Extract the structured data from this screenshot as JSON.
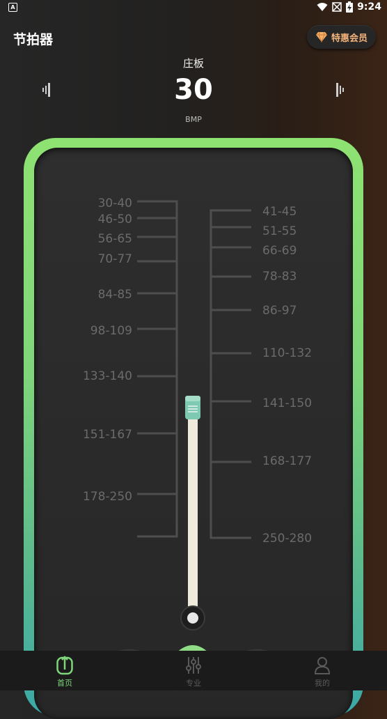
{
  "status_bar": {
    "time": "9:24",
    "notification_icon": "A"
  },
  "header": {
    "title": "节拍器",
    "vip_label": "特惠会员"
  },
  "tempo": {
    "name": "庄板",
    "bpm": "30",
    "unit": "BMP"
  },
  "scale": {
    "left_ticks": [
      "30-40",
      "46-50",
      "56-65",
      "70-77",
      "84-85",
      "98-109",
      "133-140",
      "151-167",
      "178-250"
    ],
    "right_ticks": [
      "41-45",
      "51-55",
      "66-69",
      "78-83",
      "86-97",
      "110-132",
      "141-150",
      "168-177",
      "250-280"
    ]
  },
  "nav": {
    "items": [
      {
        "label": "首页",
        "icon": "metronome-icon",
        "active": true
      },
      {
        "label": "专业",
        "icon": "sliders-icon",
        "active": false
      },
      {
        "label": "我的",
        "icon": "user-icon",
        "active": false
      }
    ]
  },
  "colors": {
    "accent": "#7fd67a",
    "vip": "#f2b27a",
    "active_nav": "#7fd67a",
    "inactive_nav": "#5a5a5a"
  }
}
